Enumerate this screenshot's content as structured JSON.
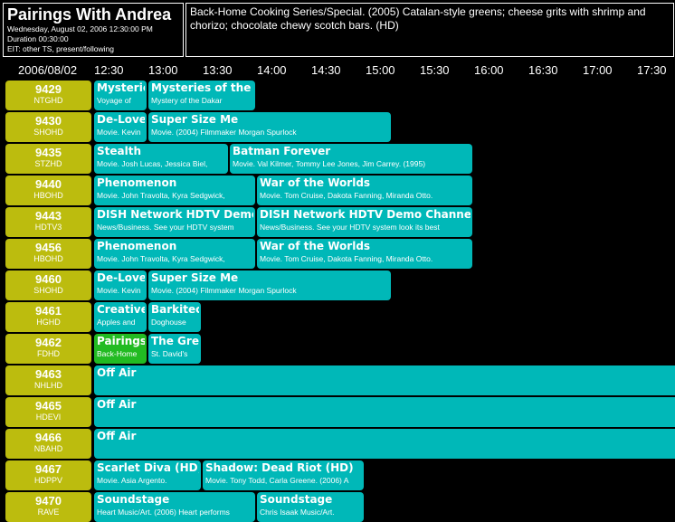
{
  "header": {
    "title": "Pairings With Andrea",
    "date_time": "Wednesday, August 02, 2006 12:30:00 PM",
    "duration": "Duration 00:30:00",
    "eit": "EIT: other TS, present/following",
    "description": "Back-Home Cooking  Series/Special.  (2005) Catalan-style greens; cheese grits with shrimp and chorizo; chocolate chewy scotch bars. (HD)"
  },
  "timebar": {
    "date": "2006/08/02",
    "times": [
      "12:30",
      "13:00",
      "13:30",
      "14:00",
      "14:30",
      "15:00",
      "15:30",
      "16:00",
      "16:30",
      "17:00",
      "17:30"
    ]
  },
  "colors": {
    "channel": "#bcbc0e",
    "program": "#00b8b8",
    "selected": "#22bb22"
  },
  "rows": [
    {
      "num": "9429",
      "call": "NTGHD",
      "programs": [
        {
          "title": "Mysterie",
          "desc": "Voyage of"
        },
        {
          "title": "Mysteries of the D",
          "desc": "Mystery of the Dakar"
        }
      ]
    },
    {
      "num": "9430",
      "call": "SHOHD",
      "programs": [
        {
          "title": "De-Love",
          "desc": "Movie.  Kevin"
        },
        {
          "title": "Super Size Me",
          "desc": "Movie.  (2004) Filmmaker Morgan Spurlock"
        }
      ]
    },
    {
      "num": "9435",
      "call": "STZHD",
      "programs": [
        {
          "title": "Stealth",
          "desc": "Movie.  Josh Lucas, Jessica Biel,"
        },
        {
          "title": "Batman Forever",
          "desc": "Movie.  Val Kilmer, Tommy Lee Jones, Jim Carrey.  (1995)"
        }
      ]
    },
    {
      "num": "9440",
      "call": "HBOHD",
      "programs": [
        {
          "title": "Phenomenon",
          "desc": "Movie.  John Travolta, Kyra Sedgwick,"
        },
        {
          "title": "War of the Worlds",
          "desc": "Movie.  Tom Cruise, Dakota Fanning, Miranda Otto."
        }
      ]
    },
    {
      "num": "9443",
      "call": "HDTV3",
      "programs": [
        {
          "title": "DISH Network HDTV Demo",
          "desc": "News/Business.  See your HDTV system"
        },
        {
          "title": "DISH Network HDTV Demo Channel",
          "desc": "News/Business.  See your HDTV system look its best"
        }
      ]
    },
    {
      "num": "9456",
      "call": "HBOHD",
      "programs": [
        {
          "title": "Phenomenon",
          "desc": "Movie.  John Travolta, Kyra Sedgwick,"
        },
        {
          "title": "War of the Worlds",
          "desc": "Movie.  Tom Cruise, Dakota Fanning, Miranda Otto."
        }
      ]
    },
    {
      "num": "9460",
      "call": "SHOHD",
      "programs": [
        {
          "title": "De-Love",
          "desc": "Movie.  Kevin"
        },
        {
          "title": "Super Size Me",
          "desc": "Movie.  (2004) Filmmaker Morgan Spurlock"
        }
      ]
    },
    {
      "num": "9461",
      "call": "HGHD",
      "programs": [
        {
          "title": "Creative",
          "desc": "Apples and"
        },
        {
          "title": "Barkitec",
          "desc": "Doghouse"
        }
      ]
    },
    {
      "num": "9462",
      "call": "FDHD",
      "programs": [
        {
          "title": "Pairings",
          "desc": "Back-Home",
          "selected": true
        },
        {
          "title": "The Gre",
          "desc": "St. David's"
        }
      ]
    },
    {
      "num": "9463",
      "call": "NHLHD",
      "programs": [
        {
          "title": "Off Air",
          "desc": ""
        }
      ]
    },
    {
      "num": "9465",
      "call": "HDEVI",
      "programs": [
        {
          "title": "Off Air",
          "desc": ""
        }
      ]
    },
    {
      "num": "9466",
      "call": "NBAHD",
      "programs": [
        {
          "title": "Off Air",
          "desc": ""
        }
      ]
    },
    {
      "num": "9467",
      "call": "HDPPV",
      "programs": [
        {
          "title": "Scarlet Diva (HD)",
          "desc": "Movie.  Asia Argento."
        },
        {
          "title": "Shadow: Dead Riot (HD)",
          "desc": "Movie.  Tony Todd, Carla Greene.  (2006) A"
        }
      ]
    },
    {
      "num": "9470",
      "call": "RAVE",
      "programs": [
        {
          "title": "Soundstage",
          "desc": "Heart  Music/Art.  (2006) Heart performs"
        },
        {
          "title": "Soundstage",
          "desc": "Chris Isaak  Music/Art."
        }
      ]
    }
  ]
}
